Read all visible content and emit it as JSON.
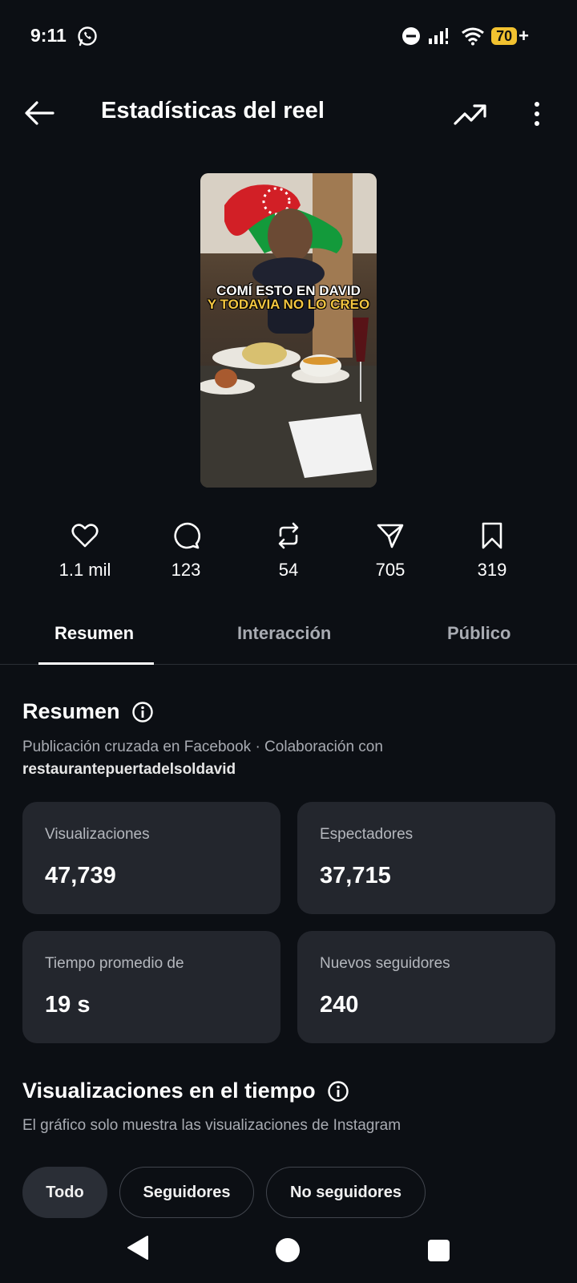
{
  "status_bar": {
    "time": "9:11",
    "battery": "70",
    "battery_suffix": "+"
  },
  "header": {
    "title": "Estadísticas del reel"
  },
  "reel_thumbnail": {
    "caption_line1": "COMÍ ESTO EN DAVID",
    "caption_line2": "Y TODAVIA NO LO CREO"
  },
  "stats": [
    {
      "icon": "heart-icon",
      "value": "1.1 mil"
    },
    {
      "icon": "comment-icon",
      "value": "123"
    },
    {
      "icon": "repost-icon",
      "value": "54"
    },
    {
      "icon": "share-icon",
      "value": "705"
    },
    {
      "icon": "bookmark-icon",
      "value": "319"
    }
  ],
  "tabs": [
    {
      "label": "Resumen",
      "active": true
    },
    {
      "label": "Interacción",
      "active": false
    },
    {
      "label": "Público",
      "active": false
    }
  ],
  "summary": {
    "title": "Resumen",
    "subtitle_prefix": "Publicación cruzada en Facebook · Colaboración con",
    "collaborator": "restaurantepuertadelsoldavid"
  },
  "cards": [
    {
      "label": "Visualizaciones",
      "value": "47,739"
    },
    {
      "label": "Espectadores",
      "value": "37,715"
    },
    {
      "label": "Tiempo promedio de",
      "value": "19 s"
    },
    {
      "label": "Nuevos seguidores",
      "value": "240"
    }
  ],
  "views_over_time": {
    "title": "Visualizaciones en el tiempo",
    "note": "El gráfico solo muestra las visualizaciones de Instagram",
    "filters": [
      "Todo",
      "Seguidores",
      "No seguidores"
    ],
    "selected_filter": "Todo"
  },
  "colors": {
    "background": "#0c0f14",
    "card": "#23262d",
    "battery": "#f2c230"
  }
}
